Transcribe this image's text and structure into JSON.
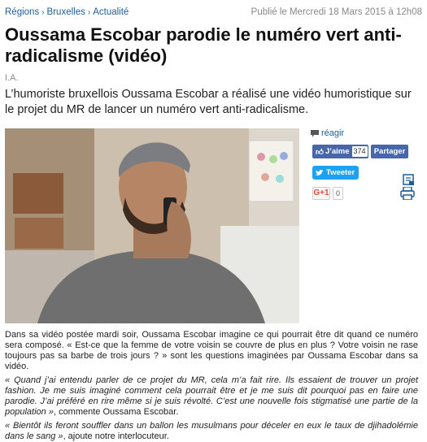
{
  "breadcrumb": {
    "items": [
      "Régions",
      "Bruxelles",
      "Actualité"
    ],
    "separator": "›"
  },
  "published": "Publié le Mercredi 18 Mars 2015 à 12h08",
  "article": {
    "title": "Oussama Escobar parodie le numéro vert anti-radicalisme (vidéo)",
    "author": "I.A.",
    "lead": "L’humoriste bruxellois Oussama Escobar a réalisé une vidéo humoristique sur le projet du MR de lancer un numéro vert anti-radicalisme.",
    "p1": "Dans sa vidéo postée mardi soir, Oussama Escobar imagine ce qui pourrait être dit quand ce numéro sera composé. « Est-ce que la femme de votre voisin se couvre de plus en plus ? Votre voisin ne rase toujours pas sa barbe de trois jours ? » sont les questions imaginées par Oussama Escobar dans sa vidéo.",
    "p2_quote": "« Quand j’ai entendu parler de ce projet du MR, cela m’a fait rire. Ils essaient de trouver un projet fashion. Je me suis imaginé comment cela pourrait être et je me suis dit pourquoi pas en faire une parodie. J’ai préféré en rire même si je suis révolté. C’est une nouvelle fois stigmatisé une partie de la population »",
    "p2_tail": ", commente Oussama Escobar.",
    "p3_quote": "« Bientôt ils feront souffler dans un ballon les musulmans pour déceler en eux le taux de djihadolémie dans le sang »",
    "p3_tail": ", ajoute notre interlocuteur."
  },
  "social": {
    "reagir_label": "réagir",
    "like_label": "J’aime",
    "like_count": "374",
    "share_label": "Partager",
    "tweet_label": "Tweeter",
    "gplus_label": "G+1",
    "gplus_count": "0"
  },
  "colors": {
    "link": "#1b5e9a",
    "facebook": "#4867aa",
    "twitter": "#1da1f2"
  }
}
